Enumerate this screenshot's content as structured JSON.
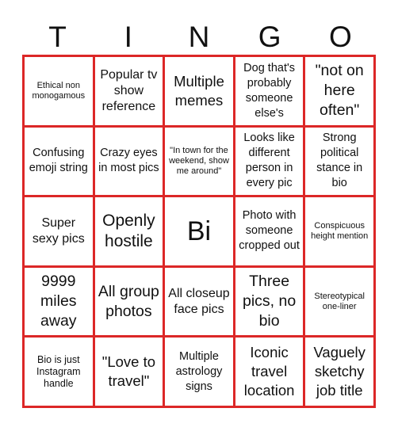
{
  "title_letters": [
    "T",
    "I",
    "N",
    "G",
    "O"
  ],
  "colors": {
    "grid": "#dc2727",
    "cell_bg": "#ffffff",
    "text": "#111111"
  },
  "cells": [
    [
      "Ethical non monogamous",
      "Popular tv show reference",
      "Multiple memes",
      "Dog that's probably someone else's",
      "\"not on here often\""
    ],
    [
      "Confusing emoji string",
      "Crazy eyes in most pics",
      "\"In town for the weekend, show me around\"",
      "Looks like different person in every pic",
      "Strong political stance in bio"
    ],
    [
      "Super sexy pics",
      "Openly hostile",
      "Bi",
      "Photo with someone cropped out",
      "Conspicuous height mention"
    ],
    [
      "9999 miles away",
      "All group photos",
      "All closeup face pics",
      "Three pics, no bio",
      "Stereotypical one-liner"
    ],
    [
      "Bio is just Instagram handle",
      "\"Love to travel\"",
      "Multiple astrology signs",
      "Iconic travel location",
      "Vaguely sketchy job title"
    ]
  ]
}
